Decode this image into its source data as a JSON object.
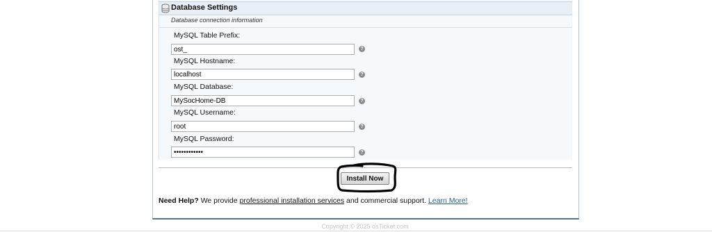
{
  "section": {
    "title": "Database Settings",
    "subtitle": "Database connection information",
    "icon": "database-icon"
  },
  "fields": [
    {
      "label": "MySQL Table Prefix:",
      "value": "ost_",
      "type": "text"
    },
    {
      "label": "MySQL Hostname:",
      "value": "localhost",
      "type": "text"
    },
    {
      "label": "MySQL Database:",
      "value": "MySocHome-DB",
      "type": "text"
    },
    {
      "label": "MySQL Username:",
      "value": "root",
      "type": "text"
    },
    {
      "label": "MySQL Password:",
      "value": "••••••••••••",
      "type": "password"
    }
  ],
  "help_glyph": "?",
  "install_button": {
    "label": "Install Now"
  },
  "help": {
    "lead": "Need Help?",
    "text1": "We provide",
    "services_link": "professional installation services",
    "text2": "and commercial support.",
    "learn_more": "Learn More!"
  },
  "footer": {
    "copyright": "Copyright © 2025 osTicket.com"
  },
  "colors": {
    "section_bg": "#f6f9fc",
    "header_bg": "#e8eff6",
    "link": "#2a5d8f",
    "panel_border": "#5a7087",
    "annotation": "#000000"
  }
}
